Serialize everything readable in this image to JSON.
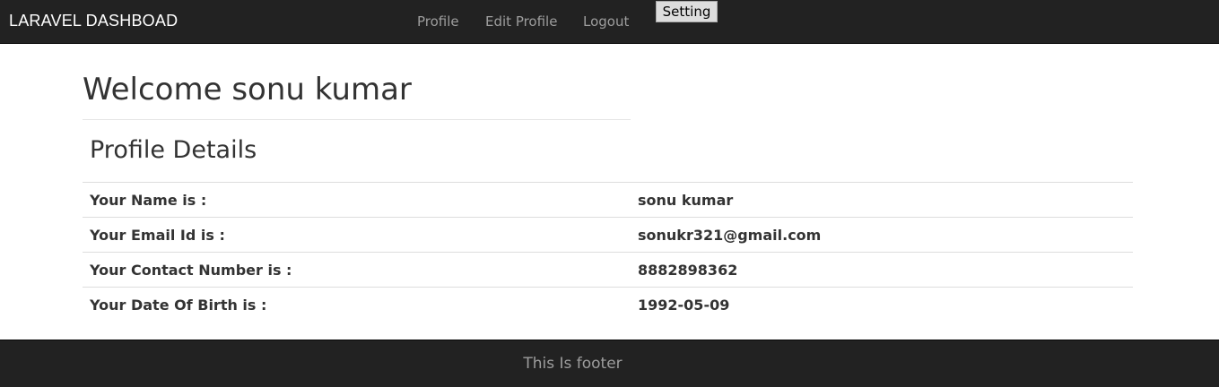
{
  "navbar": {
    "brand": "LARAVEL DASHBOAD",
    "links": [
      "Profile",
      "Edit Profile",
      "Logout"
    ],
    "setting_label": "Setting"
  },
  "main": {
    "welcome": "Welcome sonu kumar",
    "section_title": "Profile Details",
    "rows": [
      {
        "label": "Your Name is :",
        "value": "sonu kumar"
      },
      {
        "label": "Your Email Id is :",
        "value": "sonukr321@gmail.com"
      },
      {
        "label": "Your Contact Number is :",
        "value": "8882898362"
      },
      {
        "label": "Your Date Of Birth is :",
        "value": "1992-05-09"
      }
    ]
  },
  "footer": {
    "text": "This Is footer"
  }
}
